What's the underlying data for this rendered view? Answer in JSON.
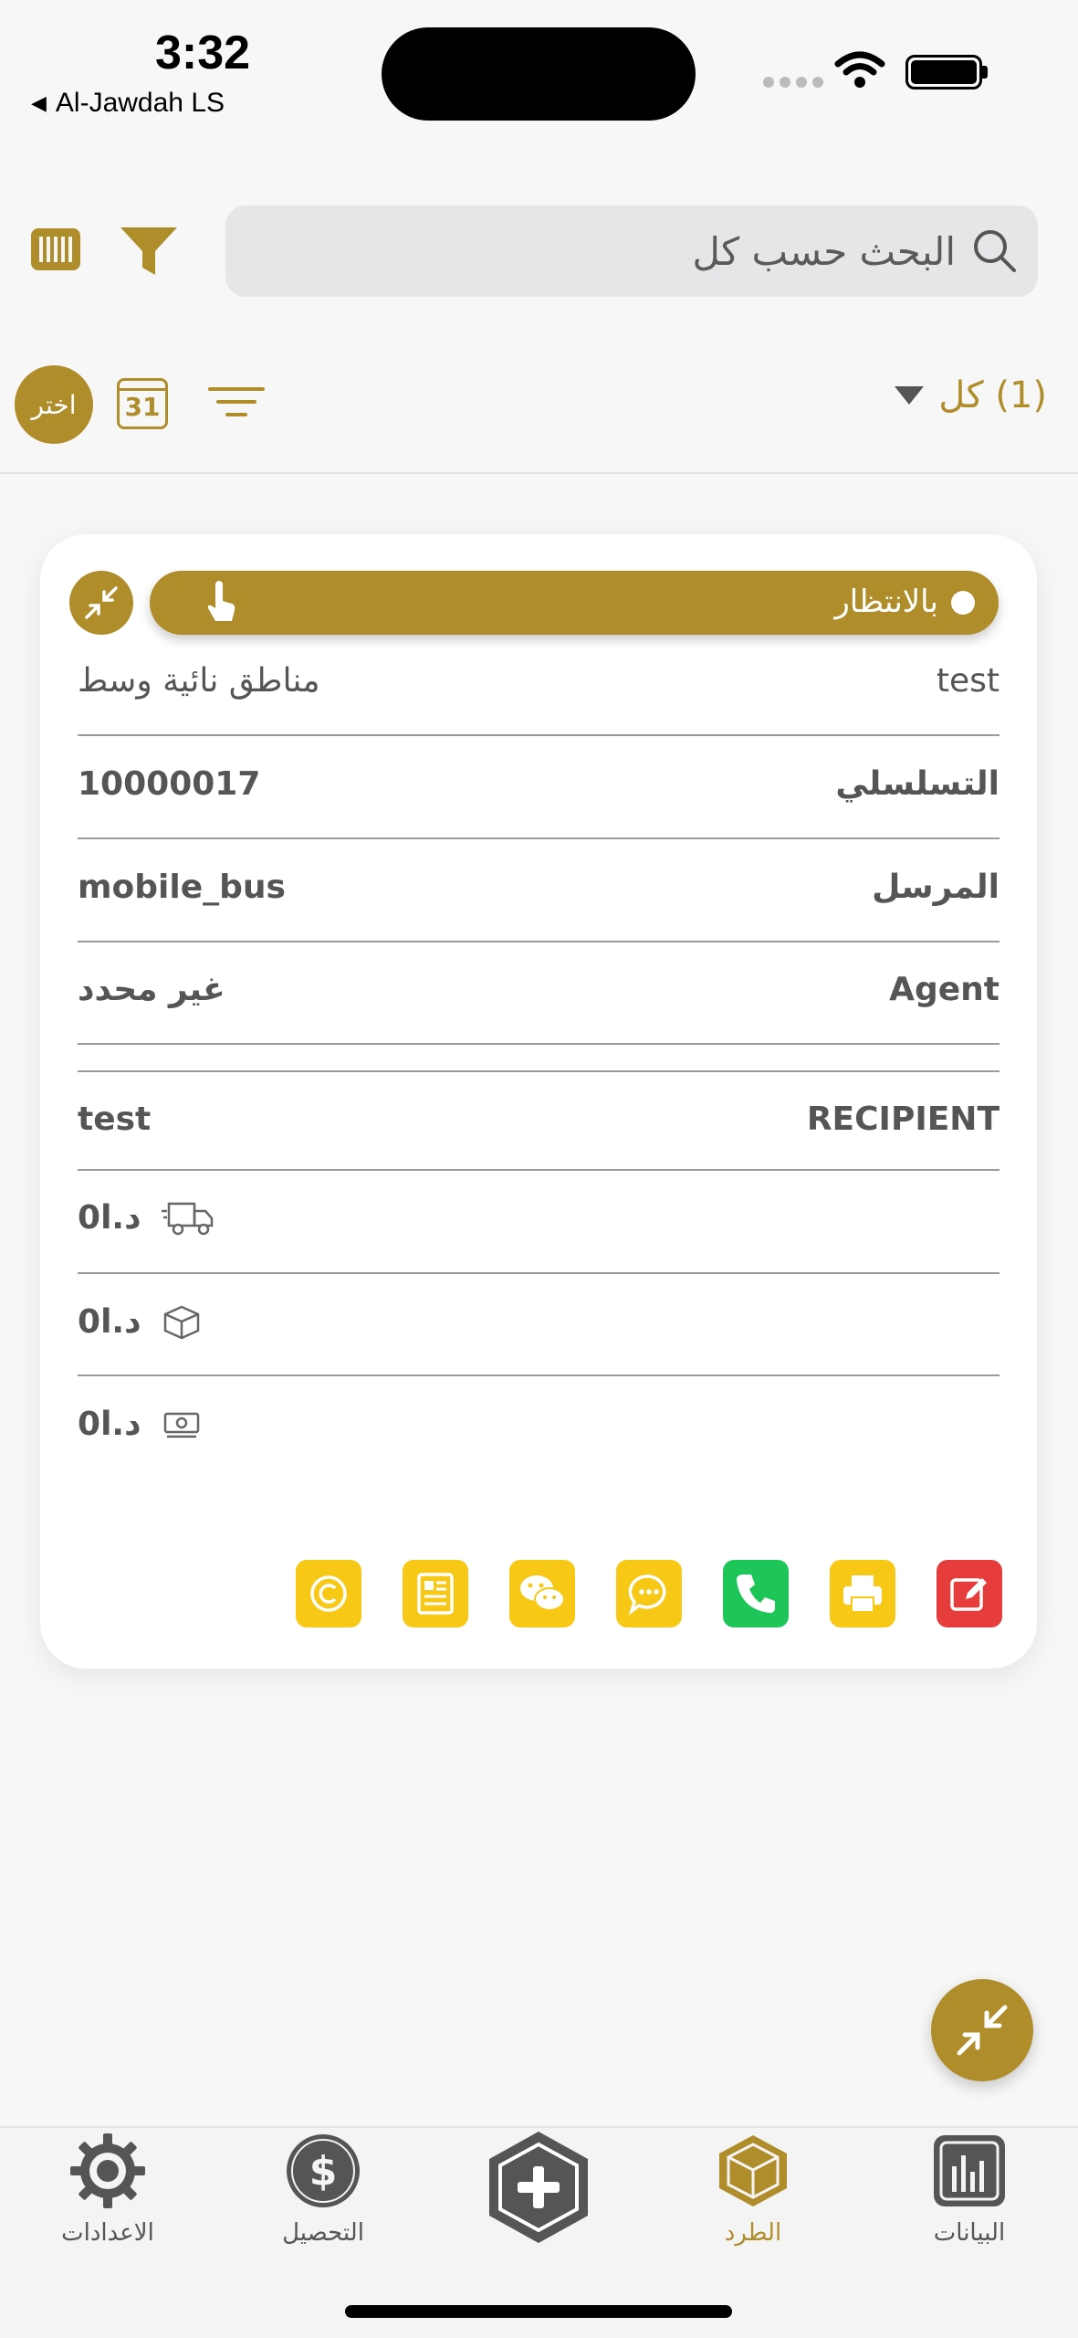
{
  "status_bar": {
    "time": "3:32",
    "back_app": "Al-Jawdah LS"
  },
  "search": {
    "placeholder": "البحث حسب كل"
  },
  "toolbar": {
    "choose_label": "اختر",
    "calendar_day": "31",
    "filter_all": "(1) كل"
  },
  "card": {
    "status": "بالانتظار",
    "area_value": "مناطق نائية وسط",
    "area_label": "test",
    "rows": [
      {
        "label": "التسلسلي",
        "value": "10000017"
      },
      {
        "label": "المرسل",
        "value": "mobile_bus"
      },
      {
        "label": "Agent",
        "value": "غير محدد"
      },
      {
        "label": "RECIPIENT",
        "value": "test"
      }
    ],
    "amounts": [
      {
        "icon": "delivery-truck-icon",
        "value": "0د.ا"
      },
      {
        "icon": "package-box-icon",
        "value": "0د.ا"
      },
      {
        "icon": "cash-icon",
        "value": "0د.ا"
      }
    ],
    "actions": [
      {
        "icon": "copyright-icon",
        "color": "#f7c816"
      },
      {
        "icon": "document-icon",
        "color": "#f7c816"
      },
      {
        "icon": "wechat-icon",
        "color": "#f7c816"
      },
      {
        "icon": "chat-bubble-icon",
        "color": "#f7c816"
      },
      {
        "icon": "phone-icon",
        "color": "#1ec65a"
      },
      {
        "icon": "printer-icon",
        "color": "#f7c816"
      },
      {
        "icon": "edit-icon",
        "color": "#e63c3c"
      }
    ]
  },
  "tabs": [
    {
      "label": "الاعدادات",
      "icon": "gear-icon",
      "active": false
    },
    {
      "label": "التحصيل",
      "icon": "dollar-icon",
      "active": false
    },
    {
      "label": "",
      "icon": "add-hexagon-icon",
      "active": false
    },
    {
      "label": "الطرد",
      "icon": "box-icon",
      "active": true
    },
    {
      "label": "البيانات",
      "icon": "bar-chart-icon",
      "active": false
    }
  ],
  "colors": {
    "accent": "#b08d2b",
    "yellow": "#f7c816",
    "green": "#1ec65a",
    "red": "#e63c3c"
  }
}
